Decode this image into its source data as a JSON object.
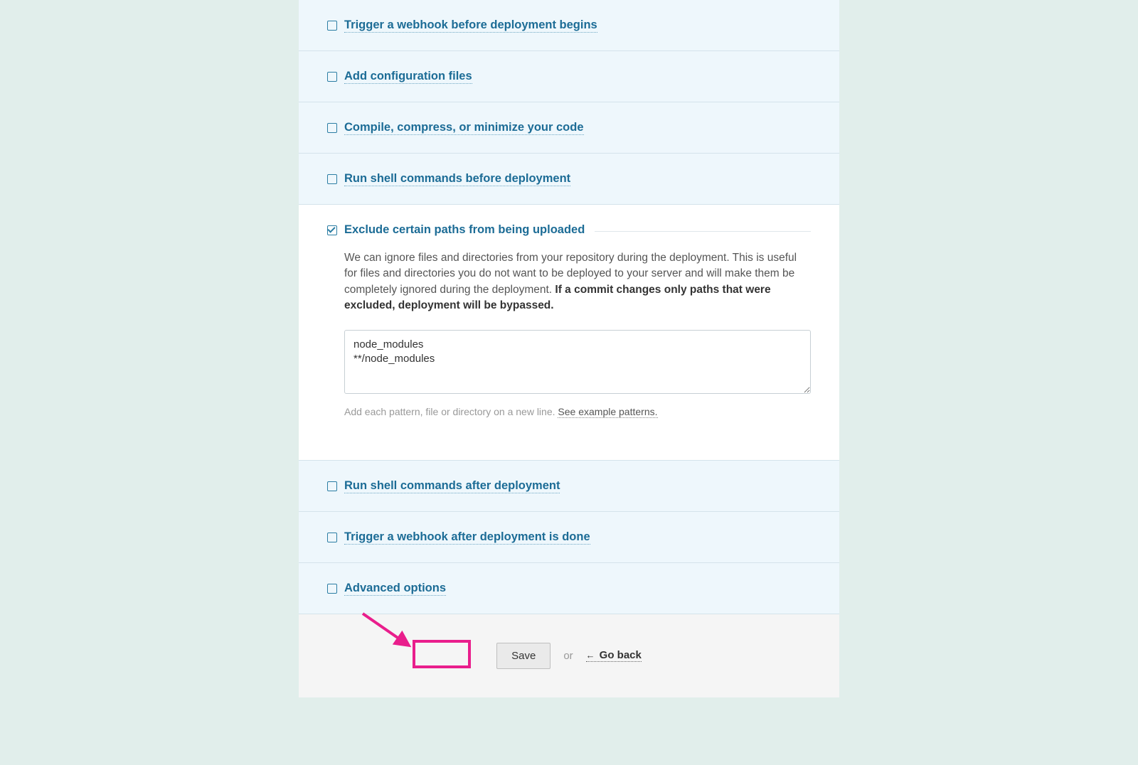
{
  "sections": [
    {
      "title": "Trigger a webhook before deployment begins",
      "checked": false
    },
    {
      "title": "Add configuration files",
      "checked": false
    },
    {
      "title": "Compile, compress, or minimize your code",
      "checked": false
    },
    {
      "title": "Run shell commands before deployment",
      "checked": false
    },
    {
      "title": "Exclude certain paths from being uploaded",
      "checked": true,
      "expanded": true
    },
    {
      "title": "Run shell commands after deployment",
      "checked": false
    },
    {
      "title": "Trigger a webhook after deployment is done",
      "checked": false
    },
    {
      "title": "Advanced options",
      "checked": false
    }
  ],
  "exclude": {
    "description_pre": "We can ignore files and directories from your repository during the deployment. This is useful for files and directories you do not want to be deployed to your server and will make them be completely ignored during the deployment. ",
    "description_bold": "If a commit changes only paths that were excluded, deployment will be bypassed.",
    "textarea_value": "node_modules\n**/node_modules",
    "hint_pre": "Add each pattern, file or directory on a new line. ",
    "hint_link": "See example patterns."
  },
  "footer": {
    "save_label": "Save",
    "or_label": "or",
    "back_label": "Go back"
  }
}
